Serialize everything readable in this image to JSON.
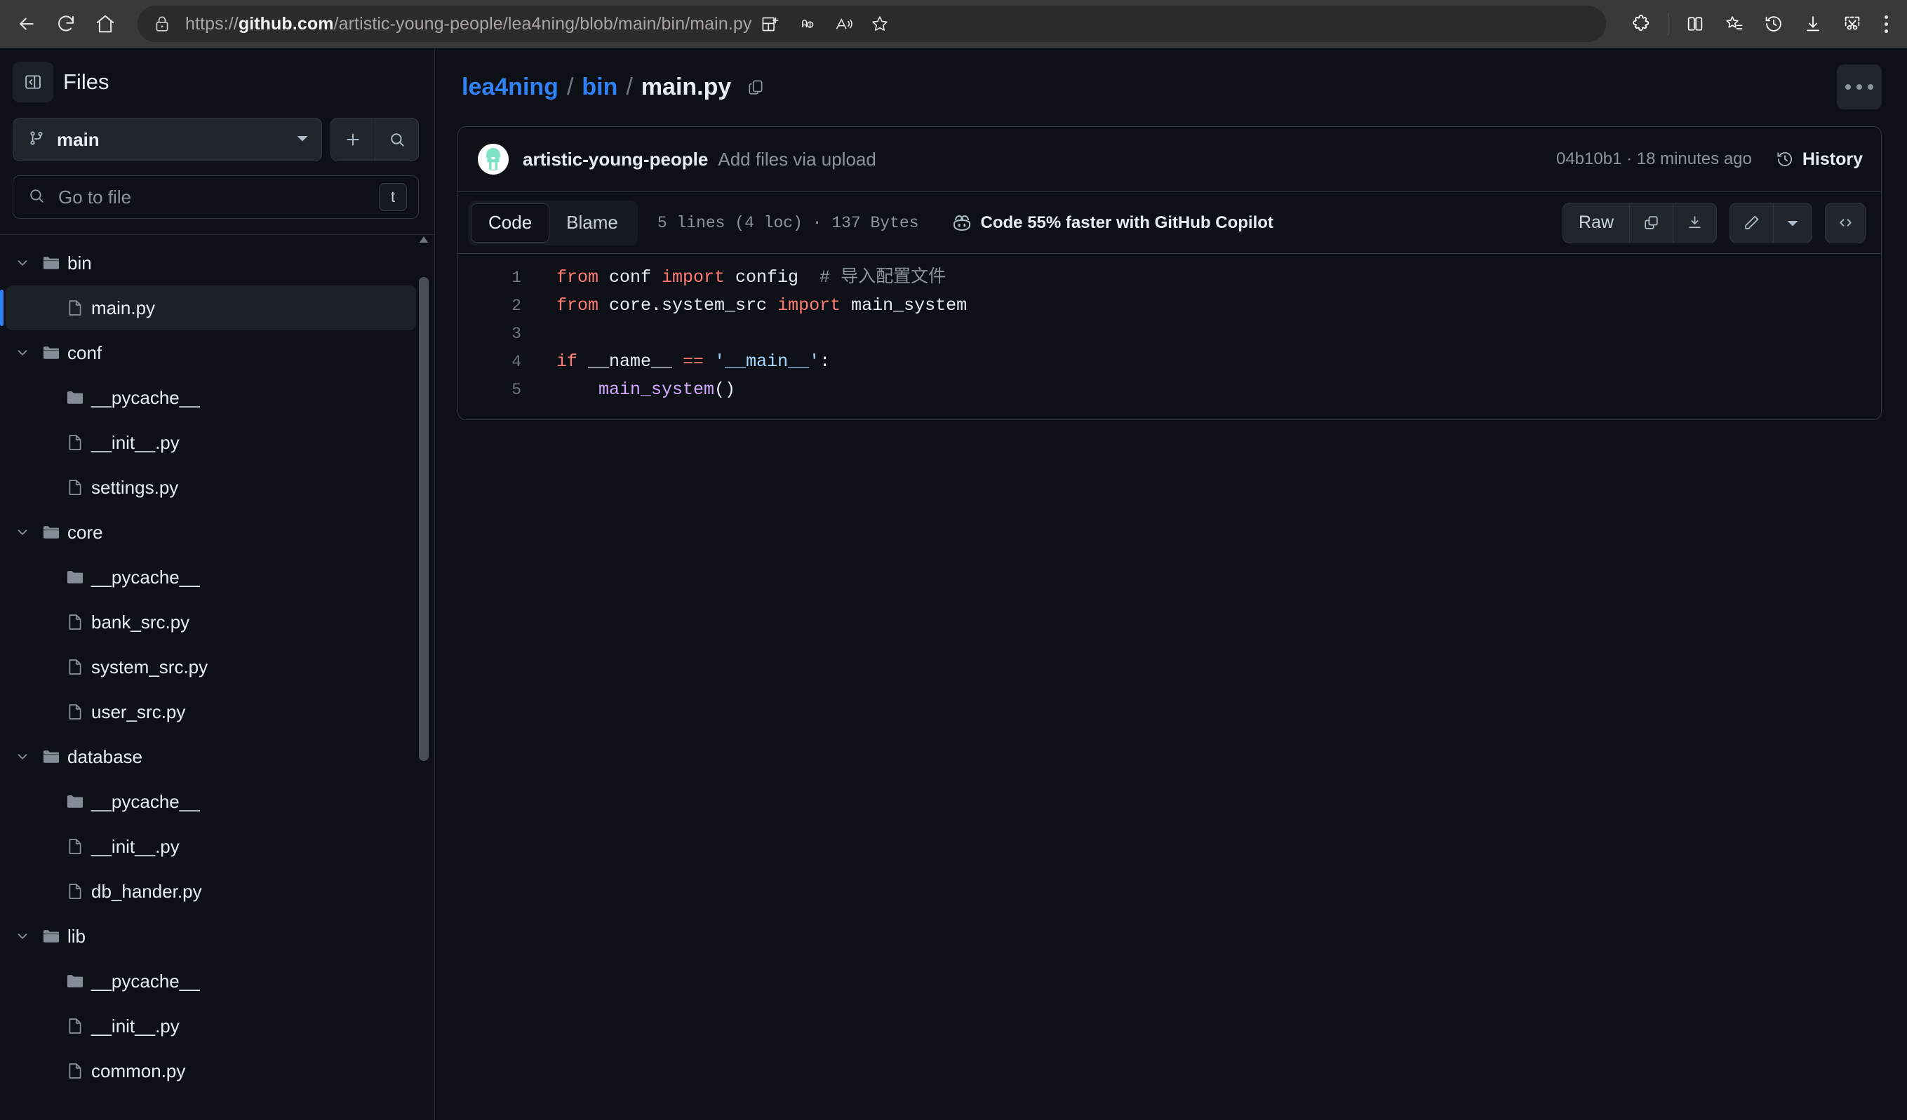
{
  "browser": {
    "back_label": "Back",
    "refresh_label": "Refresh",
    "home_label": "Home",
    "url_scheme": "https://",
    "url_host": "github.com",
    "url_path": "/artistic-young-people/lea4ning/blob/main/bin/main.py",
    "toolbar_icons": [
      {
        "name": "collections-icon",
        "label": "Collections"
      },
      {
        "name": "read-aloud-translate-icon",
        "label": "Translate"
      },
      {
        "name": "read-aloud-icon",
        "label": "Read aloud"
      },
      {
        "name": "favorite-star-icon",
        "label": "Add to favorites"
      },
      {
        "name": "extensions-puzzle-icon",
        "label": "Extensions"
      },
      {
        "name": "split-screen-icon",
        "label": "Split screen"
      },
      {
        "name": "collections-star-icon",
        "label": "Collections"
      },
      {
        "name": "history-clock-icon",
        "label": "History"
      },
      {
        "name": "downloads-icon",
        "label": "Downloads"
      },
      {
        "name": "web-capture-icon",
        "label": "Web capture"
      },
      {
        "name": "settings-more-icon",
        "label": "Settings and more"
      }
    ]
  },
  "sidebar": {
    "title": "Files",
    "collapse_label": "Collapse file tree",
    "branch": "main",
    "add_label": "Add file",
    "search_label": "Search this repository",
    "search_placeholder": "Go to file",
    "search_kbd": "t",
    "tree": [
      {
        "label": "bin",
        "type": "folder",
        "depth": 0,
        "expanded": true,
        "selected": false
      },
      {
        "label": "main.py",
        "type": "file",
        "depth": 1,
        "expanded": null,
        "selected": true
      },
      {
        "label": "conf",
        "type": "folder",
        "depth": 0,
        "expanded": true,
        "selected": false
      },
      {
        "label": "__pycache__",
        "type": "folder",
        "depth": 1,
        "expanded": false,
        "selected": false
      },
      {
        "label": "__init__.py",
        "type": "file",
        "depth": 1,
        "expanded": null,
        "selected": false
      },
      {
        "label": "settings.py",
        "type": "file",
        "depth": 1,
        "expanded": null,
        "selected": false
      },
      {
        "label": "core",
        "type": "folder",
        "depth": 0,
        "expanded": true,
        "selected": false
      },
      {
        "label": "__pycache__",
        "type": "folder",
        "depth": 1,
        "expanded": false,
        "selected": false
      },
      {
        "label": "bank_src.py",
        "type": "file",
        "depth": 1,
        "expanded": null,
        "selected": false
      },
      {
        "label": "system_src.py",
        "type": "file",
        "depth": 1,
        "expanded": null,
        "selected": false
      },
      {
        "label": "user_src.py",
        "type": "file",
        "depth": 1,
        "expanded": null,
        "selected": false
      },
      {
        "label": "database",
        "type": "folder",
        "depth": 0,
        "expanded": true,
        "selected": false
      },
      {
        "label": "__pycache__",
        "type": "folder",
        "depth": 1,
        "expanded": false,
        "selected": false
      },
      {
        "label": "__init__.py",
        "type": "file",
        "depth": 1,
        "expanded": null,
        "selected": false
      },
      {
        "label": "db_hander.py",
        "type": "file",
        "depth": 1,
        "expanded": null,
        "selected": false
      },
      {
        "label": "lib",
        "type": "folder",
        "depth": 0,
        "expanded": true,
        "selected": false
      },
      {
        "label": "__pycache__",
        "type": "folder",
        "depth": 1,
        "expanded": false,
        "selected": false
      },
      {
        "label": "__init__.py",
        "type": "file",
        "depth": 1,
        "expanded": null,
        "selected": false
      },
      {
        "label": "common.py",
        "type": "file",
        "depth": 1,
        "expanded": null,
        "selected": false
      }
    ]
  },
  "main": {
    "breadcrumb": {
      "repo": "lea4ning",
      "sep": "/",
      "folder": "bin",
      "file": "main.py",
      "copy_label": "Copy path"
    },
    "more_label": "More options",
    "commit": {
      "author": "artistic-young-people",
      "message": "Add files via upload",
      "meta": "04b10b1 · 18 minutes ago",
      "history_label": "History"
    },
    "toolbar": {
      "tab_code": "Code",
      "tab_blame": "Blame",
      "lines_info": "5 lines (4 loc) · 137 Bytes",
      "copilot_text": "Code 55% faster with GitHub Copilot",
      "raw_label": "Raw",
      "copy_label": "Copy raw content",
      "download_label": "Download raw content",
      "edit_label": "Edit this file",
      "edit_more_label": "More edit options",
      "symbols_label": "Open symbols panel"
    },
    "code": {
      "lines": [
        {
          "num": "1",
          "tokens": [
            {
              "t": "from",
              "c": "k"
            },
            {
              "t": " conf ",
              "c": "id"
            },
            {
              "t": "import",
              "c": "k"
            },
            {
              "t": " config",
              "c": "id"
            },
            {
              "t": "  # 导入配置文件",
              "c": "cm"
            }
          ]
        },
        {
          "num": "2",
          "tokens": [
            {
              "t": "from",
              "c": "k"
            },
            {
              "t": " core.system_src ",
              "c": "id"
            },
            {
              "t": "import",
              "c": "k"
            },
            {
              "t": " main_system",
              "c": "id"
            }
          ]
        },
        {
          "num": "3",
          "tokens": []
        },
        {
          "num": "4",
          "tokens": [
            {
              "t": "if",
              "c": "k"
            },
            {
              "t": " __name__ ",
              "c": "id"
            },
            {
              "t": "==",
              "c": "op"
            },
            {
              "t": " ",
              "c": "id"
            },
            {
              "t": "'__main__'",
              "c": "st"
            },
            {
              "t": ":",
              "c": "id"
            }
          ]
        },
        {
          "num": "5",
          "tokens": [
            {
              "t": "    ",
              "c": "id"
            },
            {
              "t": "main_system",
              "c": "fn"
            },
            {
              "t": "()",
              "c": "id"
            }
          ]
        }
      ]
    }
  },
  "colors": {
    "page_bg": "#0d1117",
    "border": "#30363d",
    "accent_blue": "#2f81f7",
    "keyword_red": "#ff7b72",
    "string_blue": "#a5d6ff",
    "function_purple": "#d2a8ff",
    "comment_gray": "#8b949e",
    "avatar_teal": "#7ee2c4",
    "browser_chrome": "#393939"
  }
}
